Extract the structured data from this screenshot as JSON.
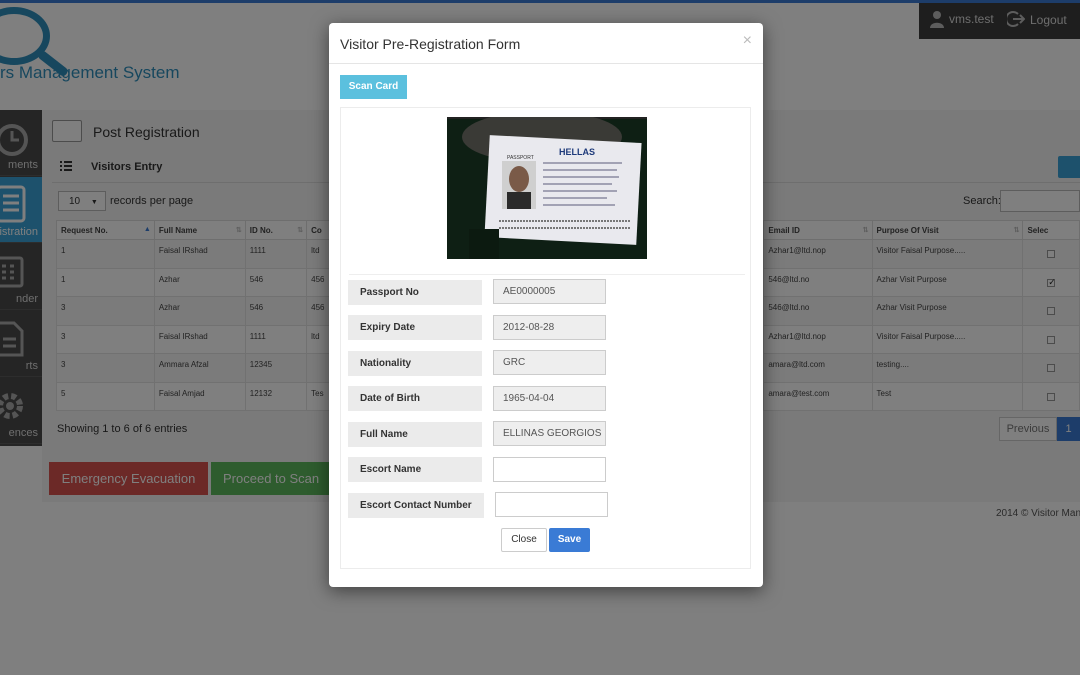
{
  "app": {
    "title_fragment": "rs Management System",
    "user_name": "vms.test",
    "logout_label": "Logout"
  },
  "sidebar": {
    "items": [
      {
        "label": "ments"
      },
      {
        "label": "gistration"
      },
      {
        "label": "nder"
      },
      {
        "label": "rts"
      },
      {
        "label": "ences"
      }
    ]
  },
  "main": {
    "page_title": "Post Registration",
    "panel_title": "Visitors Entry",
    "length_value": "10",
    "length_label": "records per page",
    "search_label": "Search:",
    "showing_text": "Showing 1 to 6 of 6 entries",
    "prev_label": "Previous",
    "page_current": "1",
    "emergency_label": "Emergency Evacuation",
    "proceed_label": "Proceed to Scan",
    "footer": "2014 © Visitor Manag"
  },
  "table": {
    "columns": [
      "Request No.",
      "Full Name",
      "ID No.",
      "Co",
      "Email ID",
      "Purpose Of Visit",
      "Selec"
    ],
    "rows": [
      {
        "req": "1",
        "name": "Faisal IRshad",
        "id": "1111",
        "co": "ltd",
        "email": "Azhar1@ltd.nop",
        "purpose": "Visitor Faisal Purpose.....",
        "checked": false
      },
      {
        "req": "1",
        "name": "Azhar",
        "id": "546",
        "co": "456",
        "email": "546@ltd.no",
        "purpose": "Azhar Visit Purpose",
        "checked": true
      },
      {
        "req": "3",
        "name": "Azhar",
        "id": "546",
        "co": "456",
        "email": "546@ltd.no",
        "purpose": "Azhar Visit Purpose",
        "checked": false
      },
      {
        "req": "3",
        "name": "Faisal IRshad",
        "id": "1111",
        "co": "ltd",
        "email": "Azhar1@ltd.nop",
        "purpose": "Visitor Faisal Purpose.....",
        "checked": false
      },
      {
        "req": "3",
        "name": "Ammara Afzal",
        "id": "12345",
        "co": "",
        "email": "amara@ltd.com",
        "purpose": "testing....",
        "checked": false
      },
      {
        "req": "5",
        "name": "Faisal Amjad",
        "id": "12132",
        "co": "Tes",
        "email": "amara@test.com",
        "purpose": "Test",
        "checked": false
      }
    ]
  },
  "modal": {
    "title": "Visitor Pre-Registration Form",
    "close_symbol": "×",
    "scan_card_label": "Scan Card",
    "card_heading": "HELLAS",
    "card_label": "PASSPORT",
    "fields": [
      {
        "label": "Passport No",
        "value": "AE0000005"
      },
      {
        "label": "Expiry Date",
        "value": "2012-08-28"
      },
      {
        "label": "Nationality",
        "value": "GRC"
      },
      {
        "label": "Date of Birth",
        "value": "1965-04-04"
      },
      {
        "label": "Full Name",
        "value": "ELLINAS  GEORGIOS"
      },
      {
        "label": "Escort Name",
        "value": ""
      },
      {
        "label": "Escort Contact Number",
        "value": ""
      }
    ],
    "close_label": "Close",
    "save_label": "Save"
  },
  "colors": {
    "accent": "#3a7bd5",
    "info": "#5bc0de",
    "danger": "#d9534f",
    "success": "#5cb85c",
    "sidebar_active": "#3aa3d8"
  }
}
